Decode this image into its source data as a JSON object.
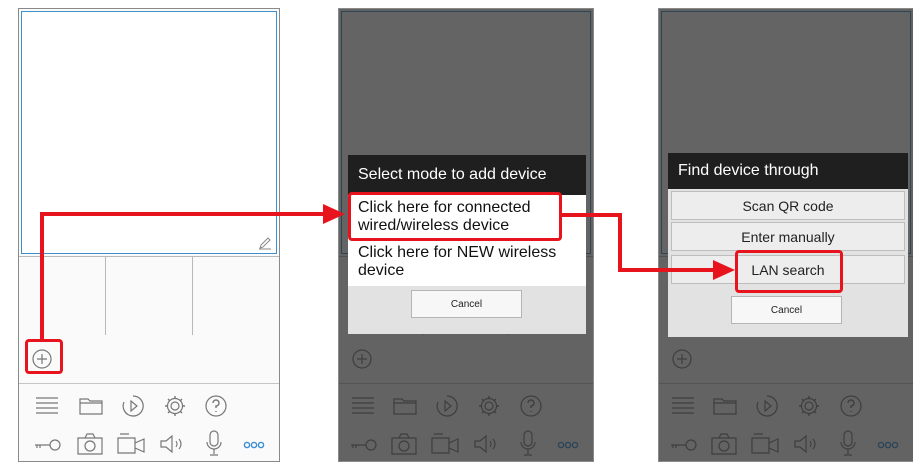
{
  "dialog_add": {
    "title": "Select mode to add device",
    "option_connected": "Click here for connected wired/wireless device",
    "option_new": "Click here for NEW wireless device",
    "cancel": "Cancel"
  },
  "dialog_find": {
    "title": "Find device through",
    "scan_qr": "Scan QR code",
    "enter_manually": "Enter manually",
    "lan_search": "LAN search",
    "cancel": "Cancel"
  },
  "toolbar_top": [
    "menu-icon",
    "folder-icon",
    "playback-icon",
    "settings-icon",
    "help-icon"
  ],
  "toolbar_bottom": [
    "key-icon",
    "camera-icon",
    "video-record-icon",
    "speaker-icon",
    "microphone-icon",
    "more-icon"
  ],
  "colors": {
    "accent": "#3f8fcc",
    "highlight": "#e8141d",
    "dialog_title_bg": "#1f1f1f",
    "more_dots": "#3a8fd6"
  }
}
